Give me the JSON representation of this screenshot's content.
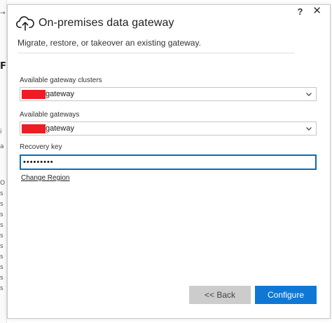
{
  "background_window": {
    "chars": [
      {
        "text": "→",
        "bold": false
      },
      {
        "text": "F",
        "bold": true
      },
      {
        "text": "i",
        "bold": false
      },
      {
        "text": "a",
        "bold": false
      },
      {
        "text": "O",
        "bold": false
      },
      {
        "text": "s",
        "bold": false
      },
      {
        "text": "s",
        "bold": false
      },
      {
        "text": "s",
        "bold": false
      },
      {
        "text": "s",
        "bold": false
      },
      {
        "text": "s",
        "bold": false
      },
      {
        "text": "s",
        "bold": false
      },
      {
        "text": "s",
        "bold": false
      },
      {
        "text": "s",
        "bold": false
      },
      {
        "text": "s",
        "bold": false
      },
      {
        "text": "s",
        "bold": false
      }
    ]
  },
  "window_controls": {
    "help": "?",
    "close": "✕"
  },
  "header": {
    "icon": "cloud-upload-icon",
    "title": "On-premises data gateway",
    "subtitle": "Migrate, restore, or takeover an existing gateway."
  },
  "form": {
    "clusters_label": "Available gateway clusters",
    "clusters_value": "gateway",
    "gateways_label": "Available gateways",
    "gateways_value": "gateway",
    "recovery_key_label": "Recovery key",
    "recovery_key_value": "•••••••••",
    "change_region": "Change Region"
  },
  "buttons": {
    "back": "<< Back",
    "configure": "Configure"
  },
  "colors": {
    "accent": "#0f78d4",
    "focus_border": "#0b6cb7",
    "redaction": "#ee1c25",
    "disabled_button": "#cccccc"
  }
}
